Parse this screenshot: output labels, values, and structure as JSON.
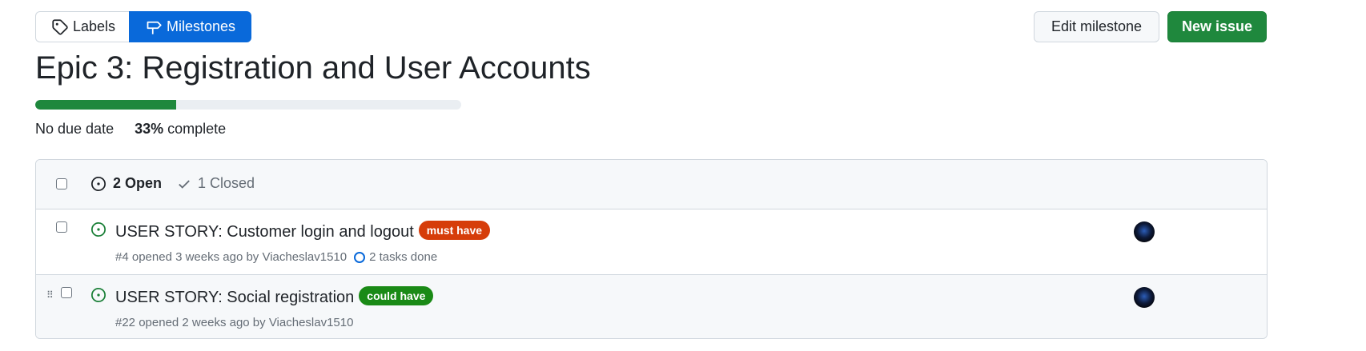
{
  "subnav": {
    "labels": "Labels",
    "milestones": "Milestones"
  },
  "actions": {
    "edit_milestone": "Edit milestone",
    "new_issue": "New issue"
  },
  "milestone": {
    "title": "Epic 3: Registration and User Accounts",
    "due": "No due date",
    "percent": "33%",
    "complete_label": "complete",
    "progress_fraction": 0.33
  },
  "issues_header": {
    "open": "2 Open",
    "closed": "1 Closed"
  },
  "issues": [
    {
      "title": "USER STORY: Customer login and logout",
      "label": "must have",
      "label_color": "#d63d0a",
      "meta": "#4 opened 3 weeks ago by Viacheslav1510",
      "tasks": "2 tasks done"
    },
    {
      "title": "USER STORY: Social registration",
      "label": "could have",
      "label_color": "#1a8a16",
      "meta": "#22 opened 2 weeks ago by Viacheslav1510"
    }
  ],
  "colors": {
    "accent_blue": "#0969da",
    "success_green": "#1f883d",
    "open_icon": "#1a7f37"
  }
}
